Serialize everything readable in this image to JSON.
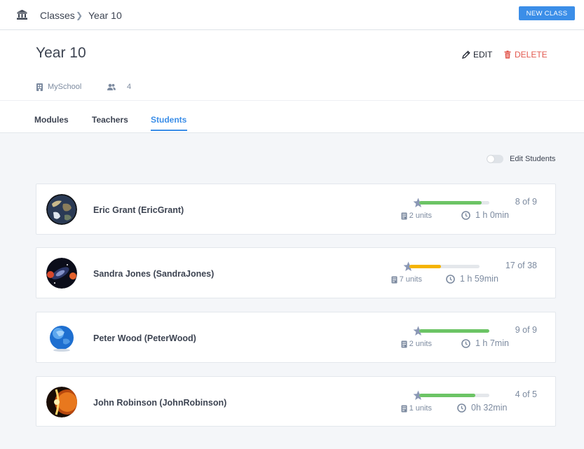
{
  "breadcrumb": {
    "root": "Classes",
    "current": "Year 10"
  },
  "actions": {
    "new_class": "NEW CLASS",
    "edit": "EDIT",
    "delete": "DELETE"
  },
  "class": {
    "title": "Year 10",
    "school": "MySchool",
    "student_count": "4"
  },
  "tabs": [
    {
      "label": "Modules",
      "active": false
    },
    {
      "label": "Teachers",
      "active": false
    },
    {
      "label": "Students",
      "active": true
    }
  ],
  "edit_students": {
    "label": "Edit Students",
    "on": false
  },
  "students": [
    {
      "name": "Eric Grant (EricGrant)",
      "progress": "8 of 9",
      "progress_fraction": 0.89,
      "bar_color": "#6cc465",
      "units": "2 units",
      "time": "1 h 0min",
      "avatar": "earth"
    },
    {
      "name": "Sandra Jones (SandraJones)",
      "progress": "17 of 38",
      "progress_fraction": 0.45,
      "bar_color": "#f5b400",
      "units": "7 units",
      "time": "1 h 59min",
      "avatar": "galaxy"
    },
    {
      "name": "Peter Wood (PeterWood)",
      "progress": "9 of 9",
      "progress_fraction": 1.0,
      "bar_color": "#6cc465",
      "units": "2 units",
      "time": "1 h 7min",
      "avatar": "blue-globe"
    },
    {
      "name": "John Robinson (JohnRobinson)",
      "progress": "4 of 5",
      "progress_fraction": 0.8,
      "bar_color": "#6cc465",
      "units": "1 units",
      "time": "0h 32min",
      "avatar": "sun"
    }
  ],
  "colors": {
    "accent": "#3b8ee8",
    "danger": "#e2594f",
    "success": "#6cc465",
    "warning": "#f5b400"
  }
}
